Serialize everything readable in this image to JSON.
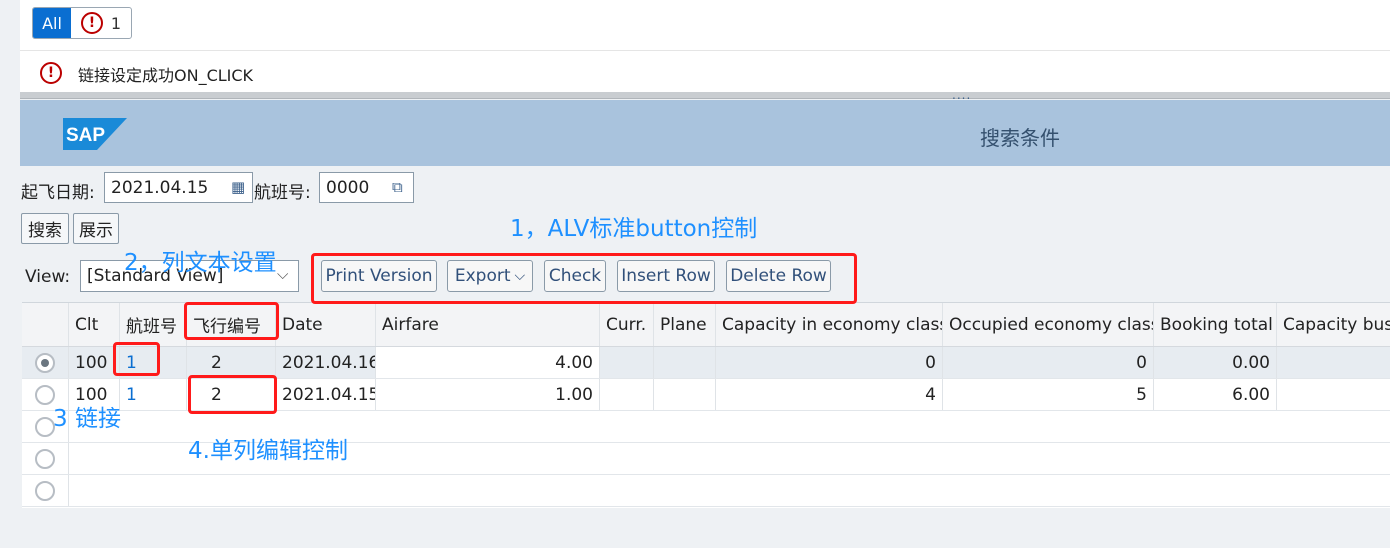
{
  "messages": {
    "filter_all": "All",
    "error_count": "1",
    "text": "链接设定成功ON_CLICK",
    "splitter_dots": "...."
  },
  "header": {
    "logo": "SAP",
    "title": "搜索条件"
  },
  "selection": {
    "date_label": "起飞日期:",
    "date_value": "2021.04.15",
    "flight_label": "航班号:",
    "flight_value": "0000",
    "search_btn": "搜索",
    "show_btn": "展示"
  },
  "alv": {
    "view_label": "View:",
    "view_value": "[Standard View]",
    "toolbar": [
      "Print Version",
      "Export",
      "Check",
      "Insert Row",
      "Delete Row"
    ],
    "columns": [
      "Clt",
      "航班号",
      "飞行编号",
      "Date",
      "Airfare",
      "Curr.",
      "Plane",
      "Capacity in economy class",
      "Occupied economy class",
      "Booking total",
      "Capacity busi"
    ],
    "rows": [
      {
        "clt": "100",
        "flight": "1",
        "flightno": "2",
        "date": "2021.04.16",
        "airfare": "4.00",
        "curr": "",
        "plane": "",
        "cap_eco": "0",
        "occ_eco": "0",
        "booking": "0.00",
        "cap_bus": ""
      },
      {
        "clt": "100",
        "flight": "1",
        "flightno": "2",
        "date": "2021.04.15",
        "airfare": "1.00",
        "curr": "",
        "plane": "",
        "cap_eco": "4",
        "occ_eco": "5",
        "booking": "6.00",
        "cap_bus": ""
      }
    ]
  },
  "annotations": {
    "a1": "1，ALV标准button控制",
    "a2": "2，列文本设置",
    "a3": "3 链接",
    "a4": "4.单列编辑控制"
  },
  "colors": {
    "accent": "#0a6ed1",
    "header_bg": "#a9c3dd",
    "annotation_red": "#ff1a1a",
    "annotation_blue": "#1e90ff"
  }
}
